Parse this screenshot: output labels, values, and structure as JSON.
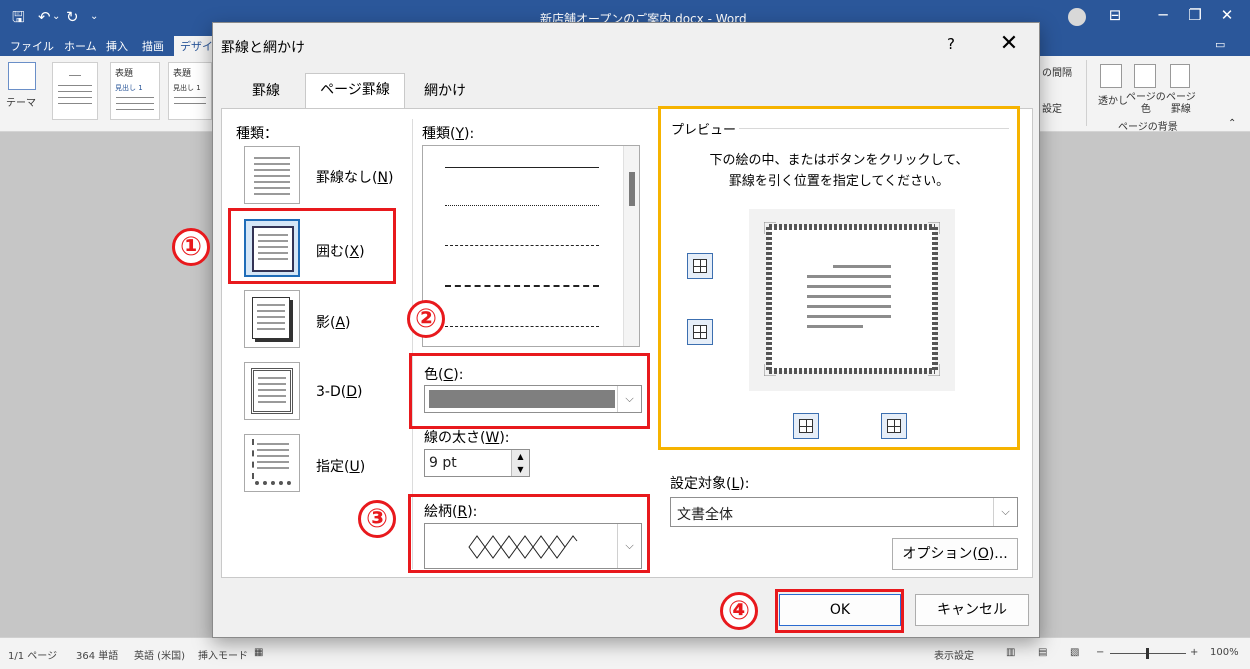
{
  "window": {
    "doc_title": "新店舗オープンのご案内.docx - Word",
    "icons": [
      "save-icon",
      "undo-icon",
      "redo-icon",
      "customize-qat-icon",
      "account-icon",
      "ribbon-display-icon",
      "minimize-icon",
      "restore-icon",
      "close-icon"
    ],
    "tab_labels": [
      "ファイル",
      "ホーム",
      "挿入",
      "描画",
      "デザイン"
    ],
    "ribbon": {
      "theme_label": "テーマ",
      "thumb1_title": "表題",
      "thumb1_heading": "見出し 1",
      "thumb2_title": "表題",
      "thumb2_heading": "見出し 1",
      "spacing_label": "の間隔",
      "effects_label": "設定",
      "watermark_label": "透かし",
      "pagecolor_label": "ページの\n色",
      "pageborder_label": "ページ\n罫線",
      "group_label": "ページの背景"
    }
  },
  "status": {
    "page": "1/1 ページ",
    "words": "364 単語",
    "language": "英語 (米国)",
    "mode": "挿入モード",
    "display_settings": "表示設定",
    "zoom": "100%"
  },
  "dialog": {
    "title": "罫線と網かけ",
    "help": "?",
    "close": "✕",
    "tabs": [
      "罫線",
      "ページ罫線",
      "網かけ"
    ],
    "selected_tab": "ページ罫線",
    "settings_header": "種類：",
    "settings": [
      {
        "label": "罫線なし(N)",
        "pre": "罫線なし(",
        "key": "N",
        "post": ")"
      },
      {
        "label": "囲む(X)",
        "pre": "囲む(",
        "key": "X",
        "post": ")"
      },
      {
        "label": "影(A)",
        "pre": "影(",
        "key": "A",
        "post": ")"
      },
      {
        "label": "3-D(D)",
        "pre": "3-D(",
        "key": "D",
        "post": ")"
      },
      {
        "label": "指定(U)",
        "pre": "指定(",
        "key": "U",
        "post": ")"
      }
    ],
    "style_header": {
      "pre": "種類(",
      "key": "Y",
      "post": "):"
    },
    "color": {
      "pre": "色(",
      "key": "C",
      "post": "):",
      "value_color": "#7f7f7f"
    },
    "width": {
      "pre": "線の太さ(",
      "key": "W",
      "post": "):",
      "value": "9 pt"
    },
    "art": {
      "pre": "絵柄(",
      "key": "R",
      "post": "):"
    },
    "preview": {
      "legend": "プレビュー",
      "instruction_line1": "下の絵の中、またはボタンをクリックして、",
      "instruction_line2": "罫線を引く位置を指定してください。"
    },
    "apply_to": {
      "pre": "設定対象(",
      "key": "L",
      "post": "):",
      "value": "文書全体"
    },
    "options_button": {
      "pre": "オプション(",
      "key": "O",
      "post": ")..."
    },
    "ok_label": "OK",
    "cancel_label": "キャンセル"
  },
  "annotations": {
    "steps": [
      "①",
      "②",
      "③",
      "④"
    ],
    "highlight_color": "#e8191d",
    "preview_box_color": "#f6b300"
  }
}
